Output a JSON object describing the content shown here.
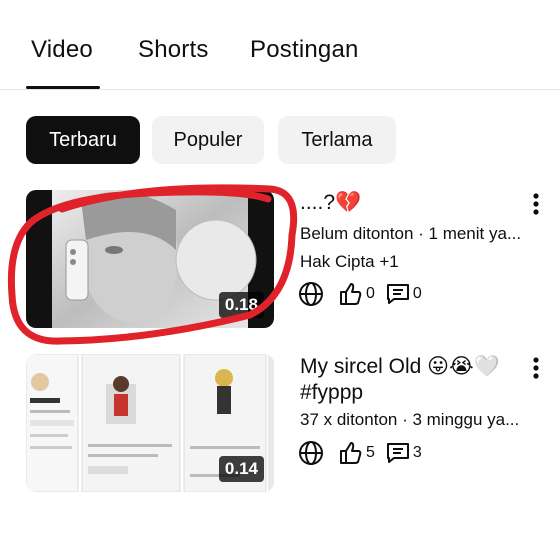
{
  "tabs": [
    {
      "label": "Video",
      "active": true
    },
    {
      "label": "Shorts",
      "active": false
    },
    {
      "label": "Postingan",
      "active": false
    }
  ],
  "chips": [
    {
      "label": "Terbaru",
      "active": true
    },
    {
      "label": "Populer",
      "active": false
    },
    {
      "label": "Terlama",
      "active": false
    }
  ],
  "videos": [
    {
      "title": "....?💔",
      "meta": "Belum ditonton · 1 menit ya...",
      "extra": "Hak Cipta +1",
      "duration": "0.18",
      "likes": "0",
      "comments": "0",
      "icons": [
        "globe-icon",
        "like-icon",
        "comment-icon",
        "more-vert-icon"
      ]
    },
    {
      "title": "My sircel Old 😛😭🤍 #fyppp",
      "meta": "37 x ditonton · 3 minggu ya...",
      "duration": "0.14",
      "likes": "5",
      "comments": "3",
      "icons": [
        "globe-icon",
        "like-icon",
        "comment-icon",
        "more-vert-icon"
      ]
    }
  ],
  "colors": {
    "text": "#0f0f0f",
    "chip_active_bg": "#0f0f0f",
    "chip_bg": "#f2f2f2",
    "scribble": "#e0222a"
  }
}
